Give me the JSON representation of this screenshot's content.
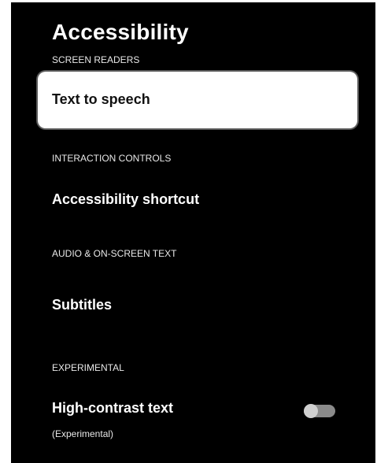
{
  "page": {
    "title": "Accessibility"
  },
  "sections": {
    "screen_readers": {
      "header": "SCREEN READERS",
      "item": "Text to speech"
    },
    "interaction_controls": {
      "header": "INTERACTION CONTROLS",
      "item": "Accessibility shortcut"
    },
    "audio_text": {
      "header": "AUDIO & ON-SCREEN TEXT",
      "item": "Subtitles"
    },
    "experimental": {
      "header": "EXPERIMENTAL",
      "item": "High-contrast text",
      "item_sub": "(Experimental)",
      "toggle_state": "off"
    }
  },
  "colors": {
    "background": "#000000",
    "focused_card": "#ffffff",
    "toggle_track": "#8a8a8a",
    "toggle_knob": "#cfcfcf"
  }
}
